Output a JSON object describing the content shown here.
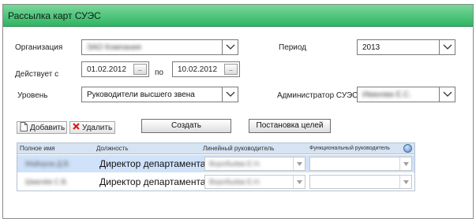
{
  "window": {
    "title": "Рассылка карт СУЭС"
  },
  "filters": {
    "organization_label": "Организация",
    "organization_value": "ЗАО Компания",
    "period_label": "Период",
    "period_value": "2013",
    "valid_label": "Действует с",
    "date_from": "01.02.2012",
    "to_label": "по",
    "date_to": "10.02.2012",
    "date_button": "..",
    "level_label": "Уровень",
    "level_value": "Руководители высшего звена",
    "admin_label": "Администратор СУЭС",
    "admin_value": "Иванова Е.С."
  },
  "toolbar": {
    "add_label": "Добавить",
    "delete_label": "Удалить",
    "create_label": "Создать",
    "goals_label": "Постановка целей"
  },
  "grid": {
    "columns": [
      "Полное имя",
      "Должность",
      "Линейный руководитель",
      "Функциональный руководитель"
    ],
    "rows": [
      {
        "name": "Майоров Д.В.",
        "position": "Директор департамента",
        "line_manager": "Воробьёва Е.Н.",
        "func_manager": ""
      },
      {
        "name": "Шмелёв С.В.",
        "position": "Директор департамента",
        "line_manager": "Воробьёва Е.Н.",
        "func_manager": ""
      }
    ]
  },
  "icons": {
    "dropdown": "chevron-down-icon",
    "add": "document-icon",
    "delete": "red-x-icon",
    "settings": "round-settings-icon"
  },
  "colors": {
    "titlebar": "#2fb463",
    "selected_row": "#cfe2fa",
    "grid_header": "#d6e3f3",
    "delete_icon": "#d0201c"
  }
}
